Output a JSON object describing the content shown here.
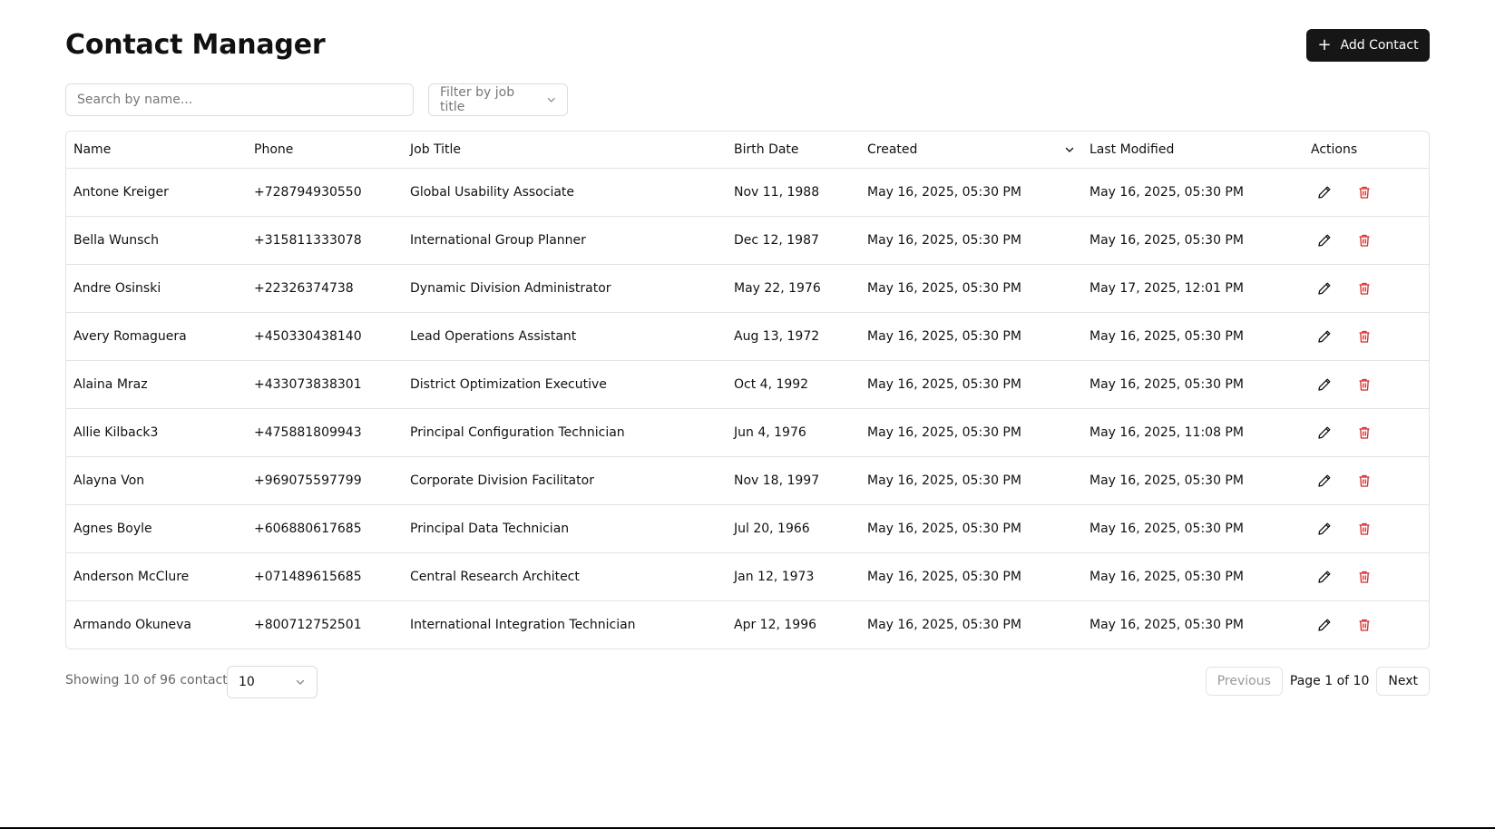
{
  "header": {
    "title": "Contact Manager",
    "add_label": "Add Contact"
  },
  "filters": {
    "search_placeholder": "Search by name...",
    "job_filter_label": "Filter by job title"
  },
  "table": {
    "columns": {
      "name": "Name",
      "phone": "Phone",
      "job": "Job Title",
      "birth": "Birth Date",
      "created": "Created",
      "modified": "Last Modified",
      "actions": "Actions"
    },
    "rows": [
      {
        "name": "Antone Kreiger",
        "phone": "+728794930550",
        "job": "Global Usability Associate",
        "birth": "Nov 11, 1988",
        "created": "May 16, 2025, 05:30 PM",
        "modified": "May 16, 2025, 05:30 PM"
      },
      {
        "name": "Bella Wunsch",
        "phone": "+315811333078",
        "job": "International Group Planner",
        "birth": "Dec 12, 1987",
        "created": "May 16, 2025, 05:30 PM",
        "modified": "May 16, 2025, 05:30 PM"
      },
      {
        "name": "Andre Osinski",
        "phone": "+22326374738",
        "job": "Dynamic Division Administrator",
        "birth": "May 22, 1976",
        "created": "May 16, 2025, 05:30 PM",
        "modified": "May 17, 2025, 12:01 PM"
      },
      {
        "name": "Avery Romaguera",
        "phone": "+450330438140",
        "job": "Lead Operations Assistant",
        "birth": "Aug 13, 1972",
        "created": "May 16, 2025, 05:30 PM",
        "modified": "May 16, 2025, 05:30 PM"
      },
      {
        "name": "Alaina Mraz",
        "phone": "+433073838301",
        "job": "District Optimization Executive",
        "birth": "Oct 4, 1992",
        "created": "May 16, 2025, 05:30 PM",
        "modified": "May 16, 2025, 05:30 PM"
      },
      {
        "name": "Allie Kilback3",
        "phone": "+475881809943",
        "job": "Principal Configuration Technician",
        "birth": "Jun 4, 1976",
        "created": "May 16, 2025, 05:30 PM",
        "modified": "May 16, 2025, 11:08 PM"
      },
      {
        "name": "Alayna Von",
        "phone": "+969075597799",
        "job": "Corporate Division Facilitator",
        "birth": "Nov 18, 1997",
        "created": "May 16, 2025, 05:30 PM",
        "modified": "May 16, 2025, 05:30 PM"
      },
      {
        "name": "Agnes Boyle",
        "phone": "+606880617685",
        "job": "Principal Data Technician",
        "birth": "Jul 20, 1966",
        "created": "May 16, 2025, 05:30 PM",
        "modified": "May 16, 2025, 05:30 PM"
      },
      {
        "name": "Anderson McClure",
        "phone": "+071489615685",
        "job": "Central Research Architect",
        "birth": "Jan 12, 1973",
        "created": "May 16, 2025, 05:30 PM",
        "modified": "May 16, 2025, 05:30 PM"
      },
      {
        "name": "Armando Okuneva",
        "phone": "+800712752501",
        "job": "International Integration Technician",
        "birth": "Apr 12, 1996",
        "created": "May 16, 2025, 05:30 PM",
        "modified": "May 16, 2025, 05:30 PM"
      }
    ]
  },
  "footer": {
    "showing": "Showing 10 of 96 contacts",
    "page_size": "10",
    "previous": "Previous",
    "page_info": "Page 1 of 10",
    "next": "Next"
  },
  "icons": {
    "add": "plus-icon",
    "edit": "pencil-icon",
    "delete": "trash-icon",
    "sort": "chevron-down-icon"
  },
  "colors": {
    "primary": "#161616",
    "delete": "#dc2626"
  }
}
